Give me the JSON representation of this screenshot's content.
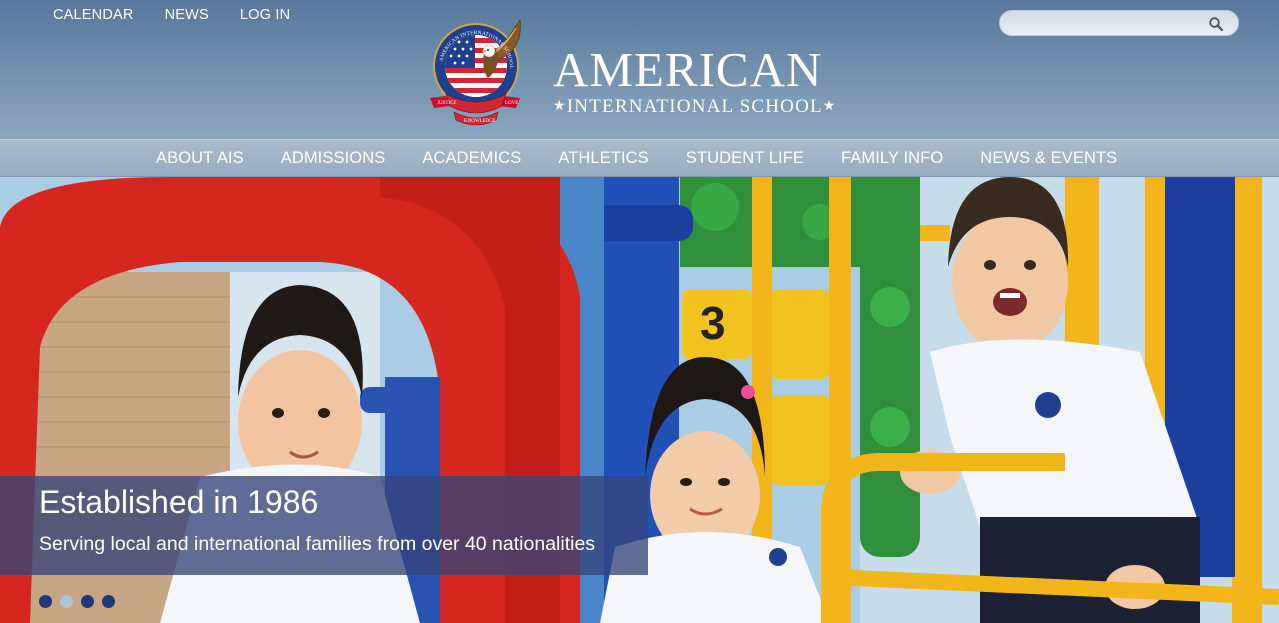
{
  "utility_nav": {
    "items": [
      {
        "label": "CALENDAR"
      },
      {
        "label": "NEWS"
      },
      {
        "label": "LOG IN"
      }
    ]
  },
  "search": {
    "placeholder": "",
    "value": "",
    "icon": "search-icon"
  },
  "logo": {
    "title": "AMERICAN",
    "subtitle": "INTERNATIONAL SCHOOL",
    "crest_ribbon": [
      "JUSTICE",
      "KNOWLEDGE",
      "LOVE"
    ],
    "crest_ring": "AMERICAN INTERNATIONAL SCHOOL"
  },
  "main_nav": {
    "items": [
      {
        "label": "ABOUT AIS"
      },
      {
        "label": "ADMISSIONS"
      },
      {
        "label": "ACADEMICS"
      },
      {
        "label": "ATHLETICS"
      },
      {
        "label": "STUDENT LIFE"
      },
      {
        "label": "FAMILY INFO"
      },
      {
        "label": "NEWS & EVENTS"
      }
    ]
  },
  "hero": {
    "caption_title": "Established in 1986",
    "caption_text": "Serving local and international families from over 40 nationalities",
    "slide_count": 4,
    "active_slide": 2
  },
  "colors": {
    "header_top": "#56789b",
    "nav_bar": "#a4b8ca",
    "caption_bg": "#34457a",
    "dot": "#1e3a78",
    "dot_active": "#a9c4dc"
  }
}
